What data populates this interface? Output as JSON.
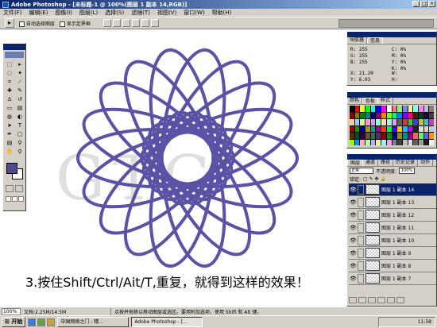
{
  "window": {
    "title": "Adobe Photoshop - [未标题-1 @ 100%(图层 1 副本 14,RGB)]"
  },
  "menu": [
    "文件(F)",
    "编辑(E)",
    "图像(I)",
    "图层(L)",
    "选择(S)",
    "滤镜(T)",
    "视图(V)",
    "窗口(W)",
    "帮助(H)"
  ],
  "options": {
    "auto_select": "自动选择图层",
    "show_bbox": "显示定界框"
  },
  "info_panel": {
    "tabs": [
      "导航器",
      "信息"
    ],
    "rgb": [
      "R:  255",
      "G:  255",
      "B:  255"
    ],
    "cmyk": [
      "C:  0%",
      "M:  0%",
      "Y:  0%",
      "K:  0%"
    ],
    "xy": [
      "X:  21.20",
      "Y:  6.03"
    ],
    "wh": [
      "W:",
      "H:"
    ]
  },
  "swatch_panel": {
    "tabs": [
      "颜色",
      "色板",
      "样式"
    ],
    "colors": [
      "#000000",
      "#ff0000",
      "#ffff00",
      "#00ff00",
      "#00ffff",
      "#0000ff",
      "#ff00ff",
      "#ffffff",
      "#ff8080",
      "#80ff80",
      "#8080ff",
      "#ffff80",
      "#80ffff",
      "#ff80ff",
      "#c0c0c0",
      "#808080",
      "#800000",
      "#808000",
      "#008000",
      "#008080",
      "#000080",
      "#800080",
      "#ff8000",
      "#80ff00",
      "#00ff80",
      "#0080ff",
      "#8000ff",
      "#ff0080",
      "#402000",
      "#004020",
      "#200040",
      "#404040",
      "#ffcc99",
      "#99ccff",
      "#ccff99",
      "#ff99cc",
      "#cc99ff",
      "#99ffcc",
      "#ffe0a0",
      "#a0ffe0",
      "#e0a0ff",
      "#606060",
      "#c04040",
      "#40c040",
      "#4040c0",
      "#c0c040",
      "#40c0c0",
      "#c040c0",
      "#a00000",
      "#00a000",
      "#0000a0",
      "#a0a000",
      "#00a0a0",
      "#a000a0",
      "#ff4000",
      "#00ff40",
      "#4000ff",
      "#ffc000",
      "#00c0ff",
      "#c000ff",
      "#202020",
      "#e0e0e0",
      "#f0d0b0",
      "#b0d0f0",
      "#503000",
      "#005030",
      "#300050",
      "#705030",
      "#307050",
      "#503070",
      "#900000",
      "#009000",
      "#000090",
      "#909000",
      "#009090",
      "#900090",
      "#ff6060",
      "#60ff60",
      "#6060ff",
      "#ff9000",
      "#90ff00",
      "#0090ff",
      "#ffb0b0",
      "#b0ffb0",
      "#b0b0ff",
      "#f0f0a0",
      "#a0f0f0",
      "#f0a0f0",
      "#7f7f7f",
      "#3f3f3f",
      "#bfbfbf",
      "#dfdfdf",
      "#5f5f5f",
      "#9f9f9f",
      "#1f1f1f",
      "#efefef"
    ]
  },
  "layers_panel": {
    "tabs": [
      "图层",
      "通道",
      "路径",
      "历史记录",
      "动作"
    ],
    "blend_mode": "正常",
    "opacity_label": "不透明度:",
    "opacity": "100%",
    "lock_label": "锁定:",
    "layers": [
      "图层 1 副本 14",
      "图层 1 副本 13",
      "图层 1 副本 12",
      "图层 1 副本 11",
      "图层 1 副本 10",
      "图层 1 副本 9",
      "图层 1 副本 8",
      "图层 1 副本 7"
    ]
  },
  "canvas": {
    "caption": "3.按住Shift/Ctrl/Ait/T,重复，就得到这样的效果！",
    "watermark": "GTC",
    "stroke_color": "#5a53a5"
  },
  "toolbox": {
    "foreground": "#4e4a90",
    "background": "#ffffff"
  },
  "status": {
    "zoom": "100%",
    "doc": "文档:2.25M/14.5M",
    "hint": "点按并拖移以移动图层或选区。要用附加选项，使用 Shift 和 Alt 键。"
  },
  "taskbar": {
    "start": "开始",
    "tasks": [
      "中国网络之门 - 精...",
      "Adobe Photoshop - [..."
    ],
    "clock": "11:58"
  }
}
